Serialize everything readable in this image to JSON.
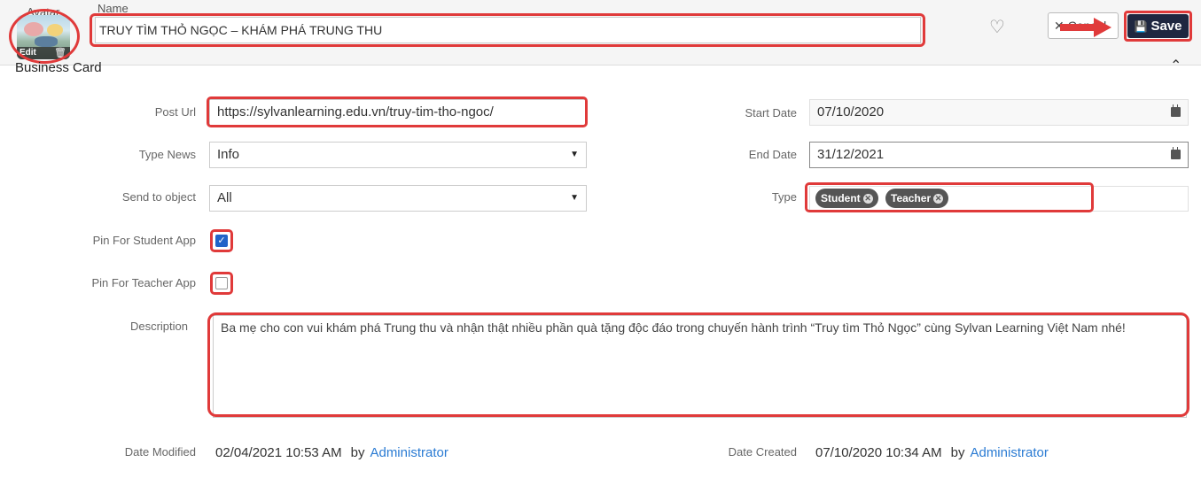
{
  "header": {
    "avatar_label": "Avatar",
    "avatar_edit": "Edit",
    "name_label": "Name",
    "name_value": "TRUY TÌM THỎ NGỌC – KHÁM PHÁ TRUNG THU",
    "cancel_label": "Cancel",
    "save_label": "Save"
  },
  "section": {
    "title": "Business Card"
  },
  "form": {
    "post_url_label": "Post Url",
    "post_url_value": "https://sylvanlearning.edu.vn/truy-tim-tho-ngoc/",
    "type_news_label": "Type News",
    "type_news_value": "Info",
    "send_to_label": "Send to object",
    "send_to_value": "All",
    "pin_student_label": "Pin For Student App",
    "pin_student_checked": true,
    "pin_teacher_label": "Pin For Teacher App",
    "pin_teacher_checked": false,
    "start_date_label": "Start Date",
    "start_date_value": "07/10/2020",
    "end_date_label": "End Date",
    "end_date_value": "31/12/2021",
    "type_label": "Type",
    "type_tags": [
      "Student",
      "Teacher"
    ],
    "description_label": "Description",
    "description_value": "Ba mẹ cho con vui khám phá Trung thu và nhận thật nhiều phần quà tặng độc đáo trong chuyến hành trình “Truy tìm Thỏ Ngọc” cùng Sylvan Learning Việt Nam nhé!"
  },
  "footer": {
    "modified_label": "Date Modified",
    "modified_value": "02/04/2021 10:53 AM",
    "modified_by_word": "by",
    "modified_by": "Administrator",
    "created_label": "Date Created",
    "created_value": "07/10/2020 10:34 AM",
    "created_by_word": "by",
    "created_by": "Administrator"
  },
  "colors": {
    "highlight": "#e03a3a",
    "save_bg": "#1f2740",
    "link": "#2a7bd3",
    "checkbox": "#2264c8"
  },
  "icons": [
    "edit-icon",
    "trash-icon",
    "heart-icon",
    "close-icon",
    "save-icon",
    "chevron-up-icon",
    "dropdown-caret-icon",
    "calendar-icon",
    "tag-remove-icon",
    "arrow-annotation"
  ]
}
